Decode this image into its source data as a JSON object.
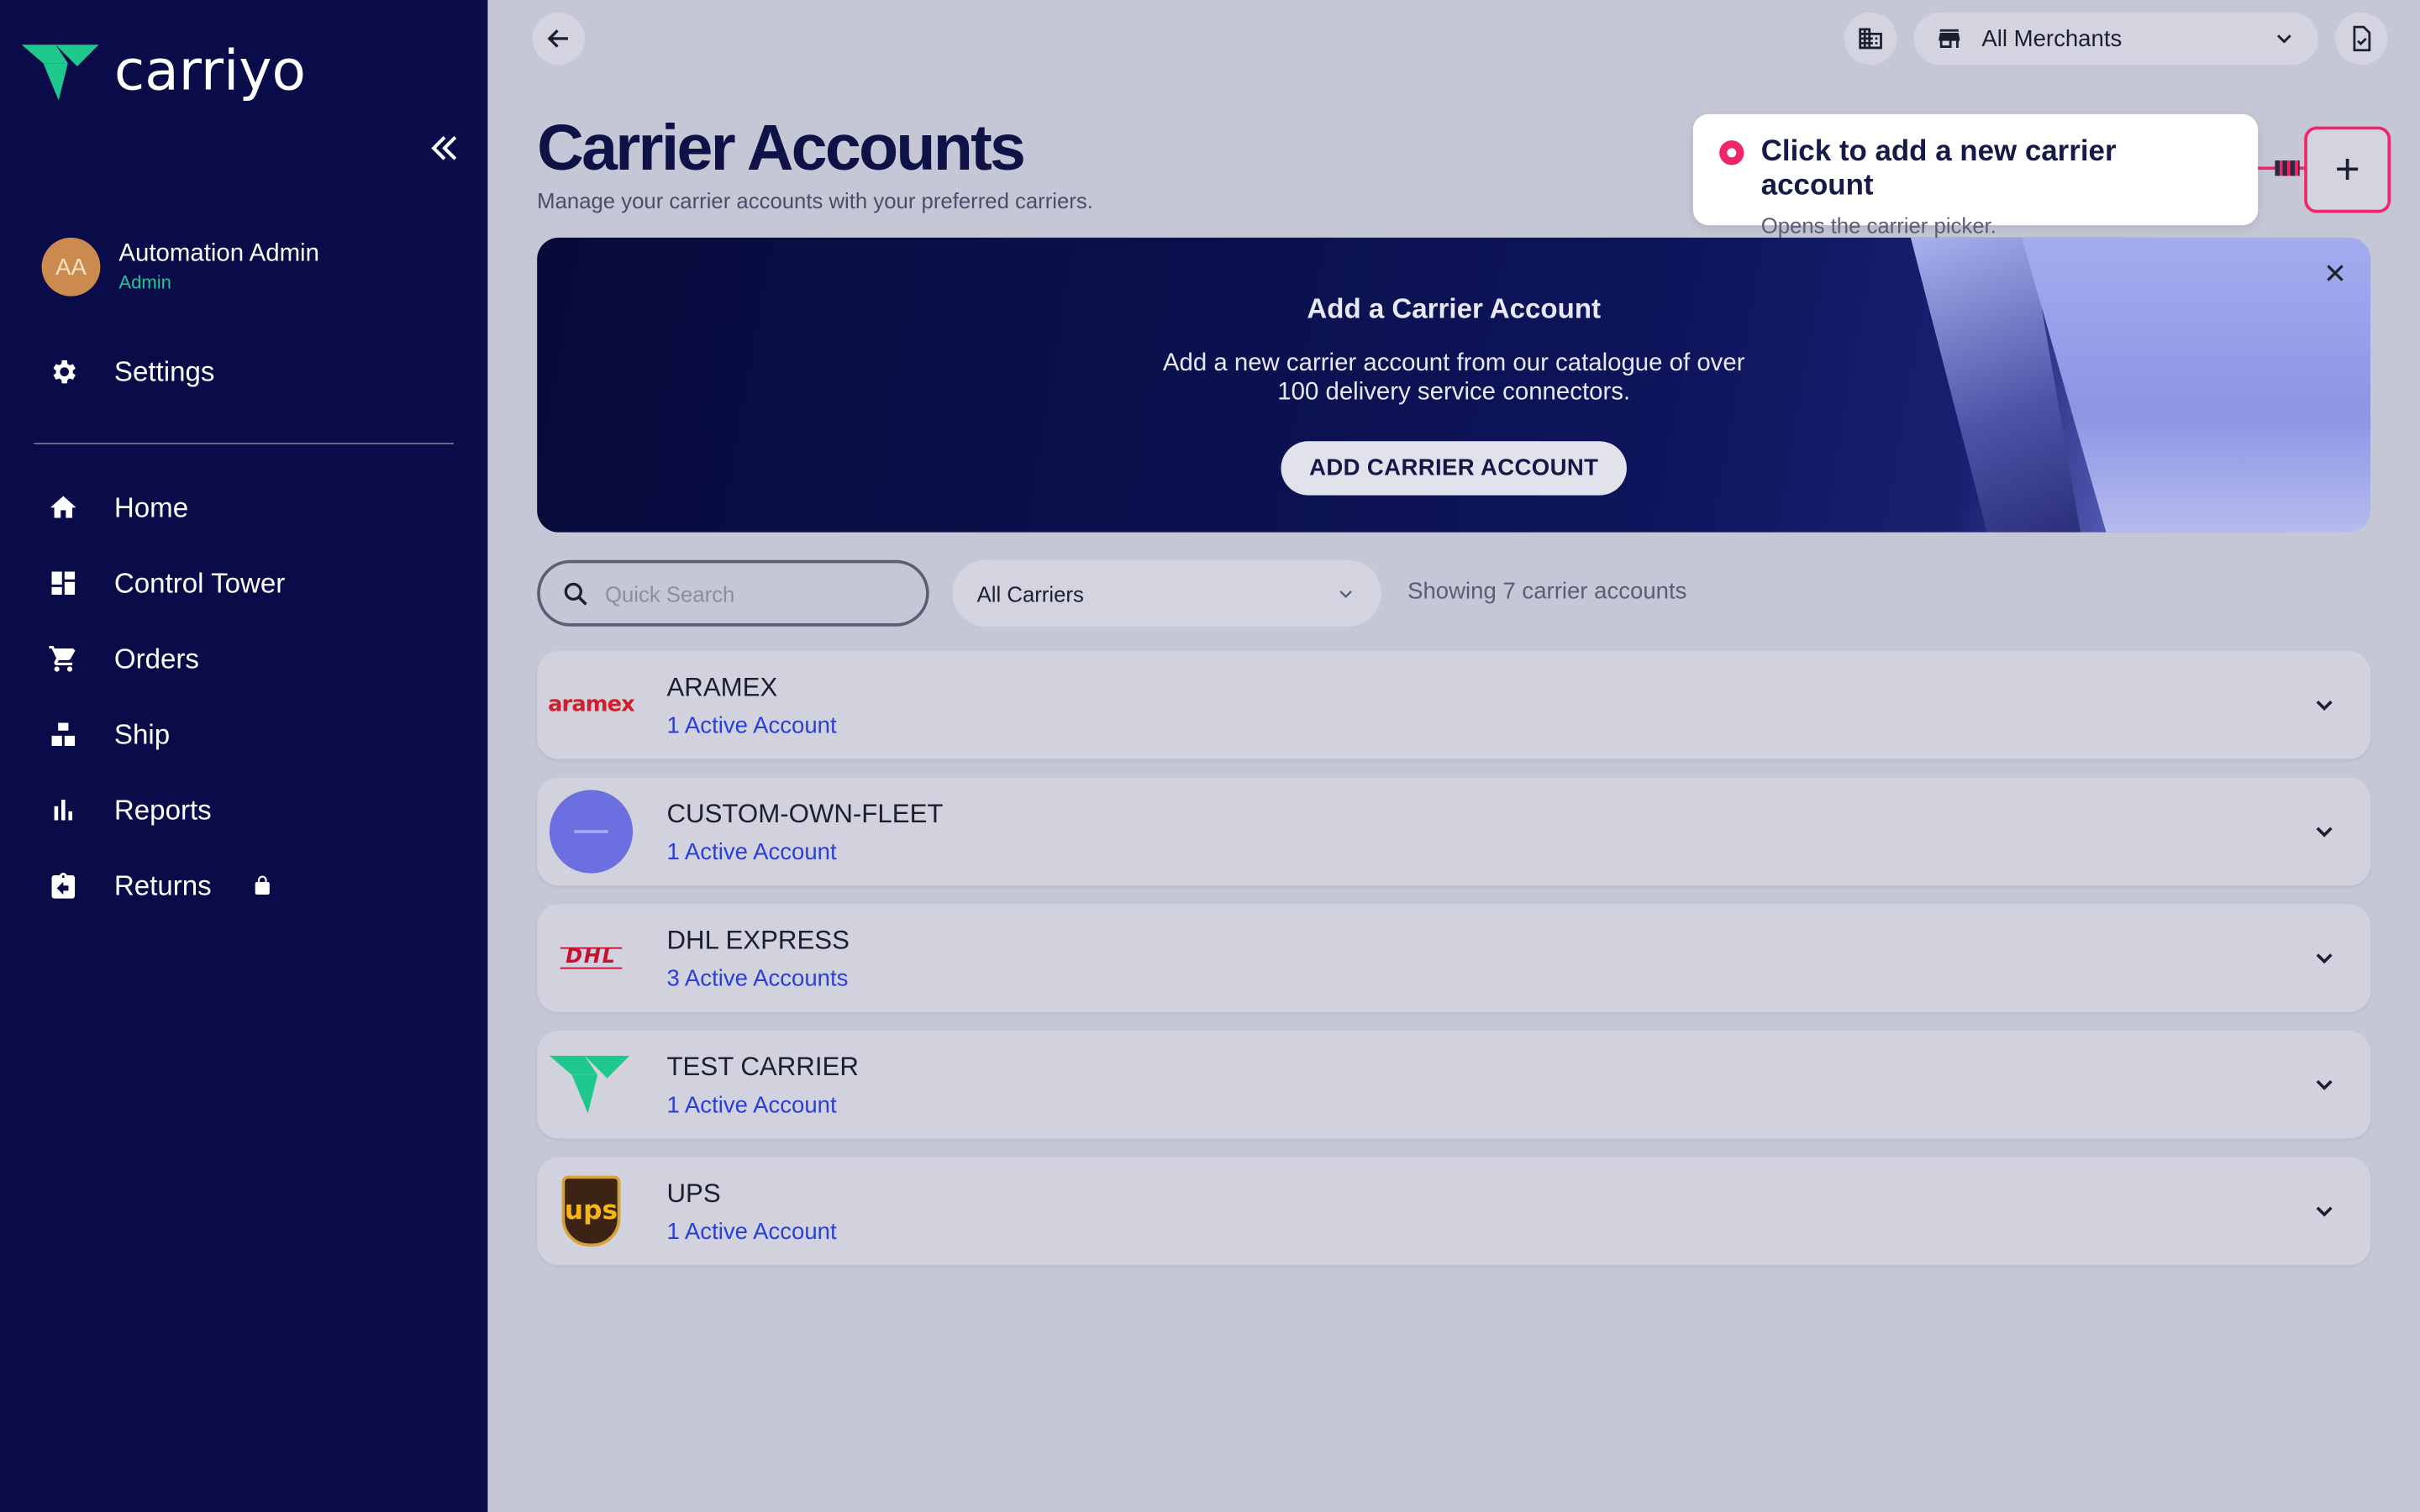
{
  "brand": {
    "name": "carriyo",
    "accent": "#1fc98e",
    "sidebar_bg": "#090c48",
    "highlight": "#f0256a"
  },
  "user": {
    "initials": "AA",
    "name": "Automation Admin",
    "role": "Admin"
  },
  "sidebar": {
    "settings": "Settings",
    "items": [
      {
        "label": "Home",
        "icon": "home-icon"
      },
      {
        "label": "Control Tower",
        "icon": "dashboard-icon"
      },
      {
        "label": "Orders",
        "icon": "cart-icon"
      },
      {
        "label": "Ship",
        "icon": "ship-icon"
      },
      {
        "label": "Reports",
        "icon": "bar-chart-icon"
      },
      {
        "label": "Returns",
        "icon": "returns-icon",
        "locked": true
      }
    ]
  },
  "header": {
    "merchant_select": "All Merchants"
  },
  "page": {
    "title": "Carrier Accounts",
    "subtitle": "Manage your carrier accounts with your preferred carriers."
  },
  "tooltip": {
    "title": "Click to add a new carrier account",
    "subtitle": "Opens the carrier picker."
  },
  "add_button": "+",
  "banner": {
    "title": "Add a Carrier Account",
    "text": "Add a new carrier account from our catalogue of over 100 delivery service connectors.",
    "button": "ADD CARRIER ACCOUNT"
  },
  "filters": {
    "search_placeholder": "Quick Search",
    "carrier_select": "All Carriers",
    "showing": "Showing 7 carrier accounts"
  },
  "carriers": [
    {
      "name": "ARAMEX",
      "accounts": "1 Active Account",
      "logo_text": "aramex"
    },
    {
      "name": "CUSTOM-OWN-FLEET",
      "accounts": "1 Active Account"
    },
    {
      "name": "DHL EXPRESS",
      "accounts": "3 Active Accounts",
      "logo_text": "DHL"
    },
    {
      "name": "TEST CARRIER",
      "accounts": "1 Active Account"
    },
    {
      "name": "UPS",
      "accounts": "1 Active Account",
      "logo_text": "ups"
    }
  ]
}
